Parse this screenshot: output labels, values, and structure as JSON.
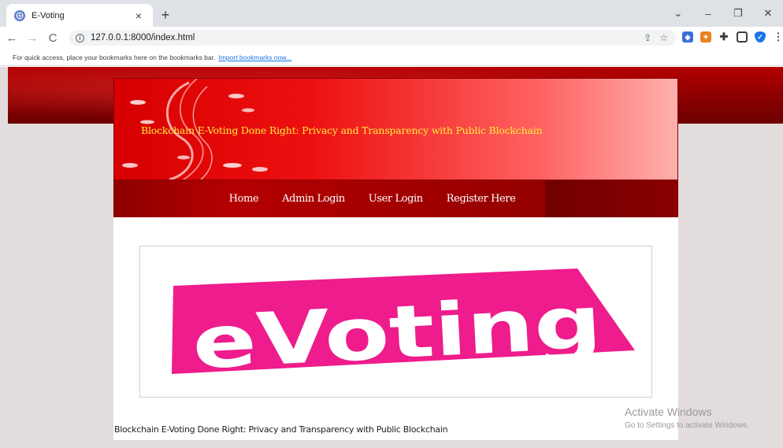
{
  "browser": {
    "tab_title": "E-Voting",
    "tab_close": "×",
    "new_tab": "+",
    "window_controls": [
      "⌄",
      "–",
      "❐",
      "✕"
    ],
    "nav": {
      "back": "←",
      "forward": "→",
      "reload": "C"
    },
    "url": "127.0.0.1:8000/index.html",
    "bookmarks_text": "For quick access, place your bookmarks here on the bookmarks bar.",
    "bookmarks_link": "Import bookmarks now..."
  },
  "site": {
    "title": "Blockchain E-Voting Done Right: Privacy and Transparency with Public Blockchain",
    "menu": [
      "Home",
      "Admin Login",
      "User Login",
      "Register Here"
    ],
    "logo_text": "eVoting",
    "footer": "Blockchain E-Voting Done Right: Privacy and Transparency with Public Blockchain"
  },
  "os_watermark": {
    "line1": "Activate Windows",
    "line2": "Go to Settings to activate Windows."
  },
  "colors": {
    "header_red": "#e00000",
    "title_yellow": "#ffec3b",
    "logo_pink": "#ee1c8c"
  }
}
